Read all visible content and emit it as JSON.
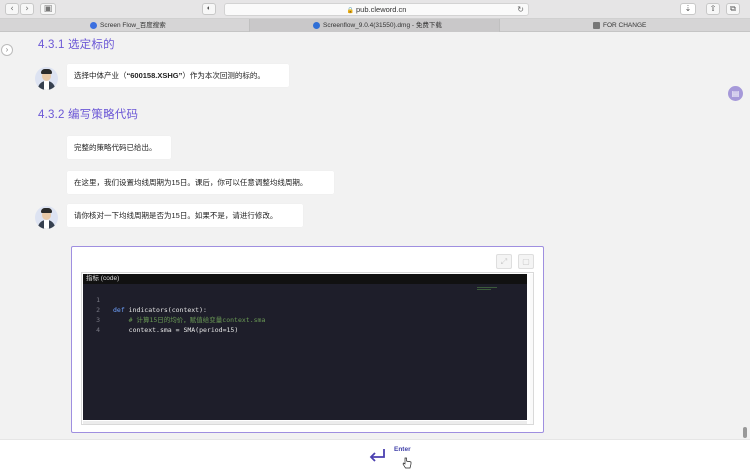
{
  "browser": {
    "url": "pub.cleword.cn",
    "tabs": [
      {
        "label": "Screen Flow_百度搜索",
        "favicon_color": "#3b6fe0"
      },
      {
        "label": "Screenflow_9.0.4(31550).dmg - 免费下载",
        "favicon_color": "#2f6fd6"
      },
      {
        "label": "FOR CHANGE",
        "favicon_color": "#777777"
      }
    ]
  },
  "content": {
    "section_1_title": "4.3.1 选定标的",
    "msg_1_prefix": "选择中体产业（",
    "msg_1_ticker": "“600158.XSHG”",
    "msg_1_suffix": "）作为本次回测的标的。",
    "section_2_title": "4.3.2 编写策略代码",
    "msg_2": "完整的策略代码已给出。",
    "msg_3": "在这里，我们设置均线周期为15日。课后，你可以任意调整均线周期。",
    "msg_4": "请你核对一下均线周期是否为15日。如果不是，请进行修改。"
  },
  "editor": {
    "header": "指标 (code)",
    "lines": [
      {
        "num": "1",
        "kw": "def ",
        "text": "indicators(context):",
        "type": "def"
      },
      {
        "num": "2",
        "kw": "",
        "text": "    # 计算15日的均价，赋值给变量context.sma",
        "type": "comment"
      },
      {
        "num": "3",
        "kw": "",
        "text": "    context.sma = SMA(period=15)",
        "type": "code"
      },
      {
        "num": "4",
        "kw": "",
        "text": "",
        "type": "code"
      }
    ]
  },
  "footer": {
    "enter_label": "Enter"
  },
  "colors": {
    "accent": "#6b57d6",
    "editor_bg": "#1e1e2a",
    "card_border": "#9f8fe0"
  }
}
